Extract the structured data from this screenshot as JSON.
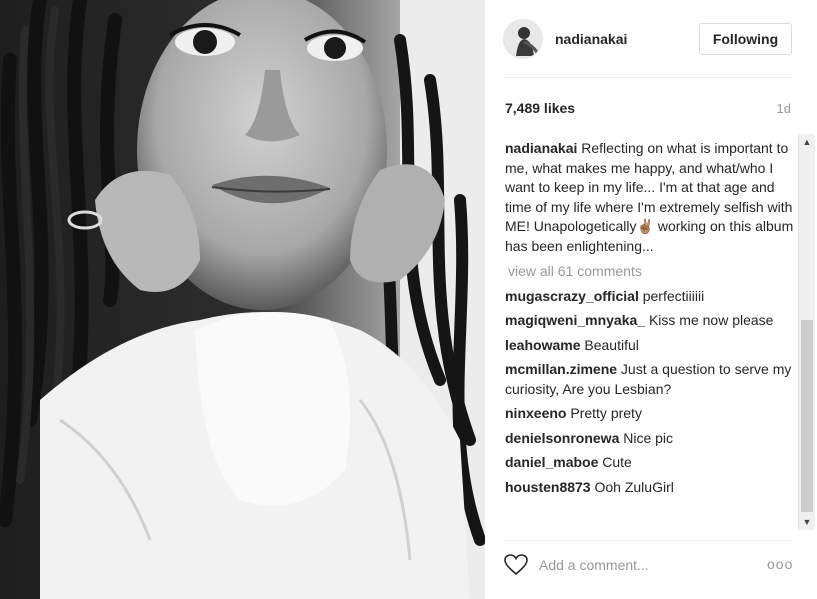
{
  "post": {
    "username": "nadianakai",
    "follow_label": "Following",
    "likes": "7,489 likes",
    "age": "1d"
  },
  "caption": {
    "username": "nadianakai",
    "text": " Reflecting on what is important to me, what makes me happy, and what/who I want to keep in my life... I'm at that age and time of my life where I'm extremely selfish with ME! Unapologetically✌🏽 working on this album has been enlightening..."
  },
  "view_all": "view all 61 comments",
  "comments": [
    {
      "user": "mugascrazy_official",
      "text": " perfectiiiiii"
    },
    {
      "user": "magiqweni_mnyaka_",
      "text": " Kiss me now please"
    },
    {
      "user": "leahowame",
      "text": " Beautiful"
    },
    {
      "user": "mcmillan.zimene",
      "text": " Just a question to serve my curiosity, Are you Lesbian?"
    },
    {
      "user": "ninxeeno",
      "text": " Pretty prety"
    },
    {
      "user": "denielsonronewa",
      "text": " Nice pic"
    },
    {
      "user": "daniel_maboe",
      "text": " Cute"
    },
    {
      "user": "housten8873",
      "text": " Ooh ZuluGirl"
    }
  ],
  "comment_input": {
    "placeholder": "Add a comment..."
  },
  "more_label": "ooo",
  "icons": {
    "like": "heart-icon",
    "more": "more-options-icon"
  }
}
